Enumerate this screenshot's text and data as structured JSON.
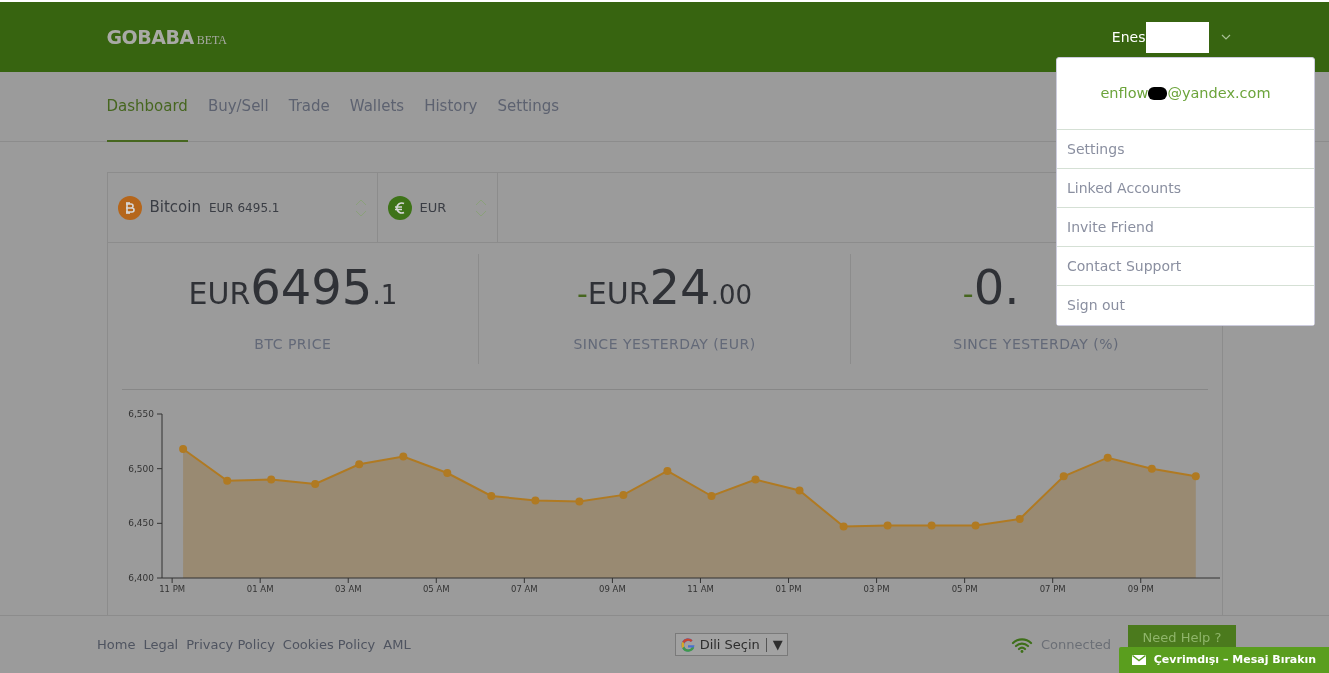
{
  "header": {
    "logo": "GOBABA",
    "logo_badge": "BETA",
    "user": "Enes",
    "menu_expanded": true
  },
  "nav": [
    {
      "label": "Dashboard",
      "selected": true
    },
    {
      "label": "Buy/Sell",
      "selected": false
    },
    {
      "label": "Trade",
      "selected": false
    },
    {
      "label": "Wallets",
      "selected": false
    },
    {
      "label": "History",
      "selected": false
    },
    {
      "label": "Settings",
      "selected": false
    }
  ],
  "user_menu": {
    "email_start": "enflow",
    "email_end": "@yandex.com",
    "items": [
      "Settings",
      "Linked Accounts",
      "Invite Friend",
      "Contact Support",
      "Sign out"
    ]
  },
  "selectors": [
    {
      "kind": "crypto",
      "name": "Bitcoin",
      "price": "EUR 6495.1"
    },
    {
      "kind": "fiat",
      "name": "EUR"
    }
  ],
  "stats": [
    {
      "currency": "EUR",
      "integer": "6495",
      "decimals": ".1",
      "label": "BTC PRICE"
    },
    {
      "sign": "-",
      "currency": "EUR",
      "integer": "24",
      "decimals": ".00",
      "label": "SINCE YESTERDAY (EUR)"
    },
    {
      "sign": "-",
      "integer": "0.",
      "label": "SINCE YESTERDAY (%)"
    }
  ],
  "chart_data": {
    "type": "area",
    "categories": [
      "11 PM",
      null,
      "01 AM",
      null,
      "03 AM",
      null,
      "05 AM",
      null,
      "07 AM",
      null,
      "09 AM",
      null,
      "11 AM",
      null,
      "01 PM",
      null,
      "03 PM",
      null,
      "05 PM",
      null,
      "07 PM",
      null,
      "09 PM",
      null
    ],
    "series": [
      {
        "color": "#b07a22",
        "values": [
          6518,
          6489,
          6490,
          6486,
          6504,
          6511,
          6496,
          6475,
          6471,
          6470,
          6476,
          6498,
          6475,
          6490,
          6480,
          6447,
          6448,
          6448,
          6448,
          6454,
          6493,
          6510,
          6500,
          6493
        ]
      }
    ],
    "ylim": [
      6400,
      6550
    ],
    "yticks": [
      {
        "value": 6400,
        "label": "6,400"
      },
      {
        "value": 6450,
        "label": "6,450"
      },
      {
        "value": 6500,
        "label": "6,500"
      },
      {
        "value": 6550,
        "label": "6,550"
      }
    ]
  },
  "footer": {
    "links": [
      "Home",
      "Legal",
      "Privacy Policy",
      "Cookies Policy",
      "AML"
    ],
    "language": "Dili Seçin",
    "language_arrow": "▼",
    "connection": "Connected",
    "help": "Need Help ?"
  },
  "chat": {
    "label": "Çevrimdışı – Mesaj Bırakın"
  }
}
